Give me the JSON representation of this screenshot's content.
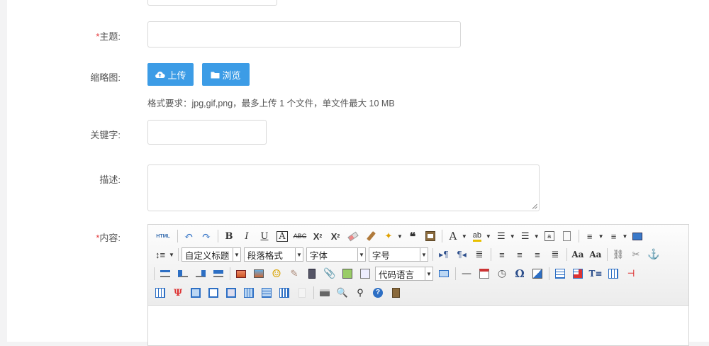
{
  "form": {
    "subject_label": "主题:",
    "thumbnail_label": "缩略图:",
    "upload_label": "上传",
    "browse_label": "浏览",
    "format_hint": "格式要求：jpg,gif,png，最多上传 1 个文件，单文件最大 10 MB",
    "keyword_label": "关键字:",
    "description_label": "描述:",
    "content_label": "内容:",
    "required_mark": "*"
  },
  "editor": {
    "custom_heading": "自定义标题",
    "paragraph_format": "段落格式",
    "font_family": "字体",
    "font_size": "字号",
    "code_language": "代码语言",
    "html_button": "HTML"
  },
  "colors": {
    "accent": "#3c9ce6",
    "required": "#e4393c"
  }
}
